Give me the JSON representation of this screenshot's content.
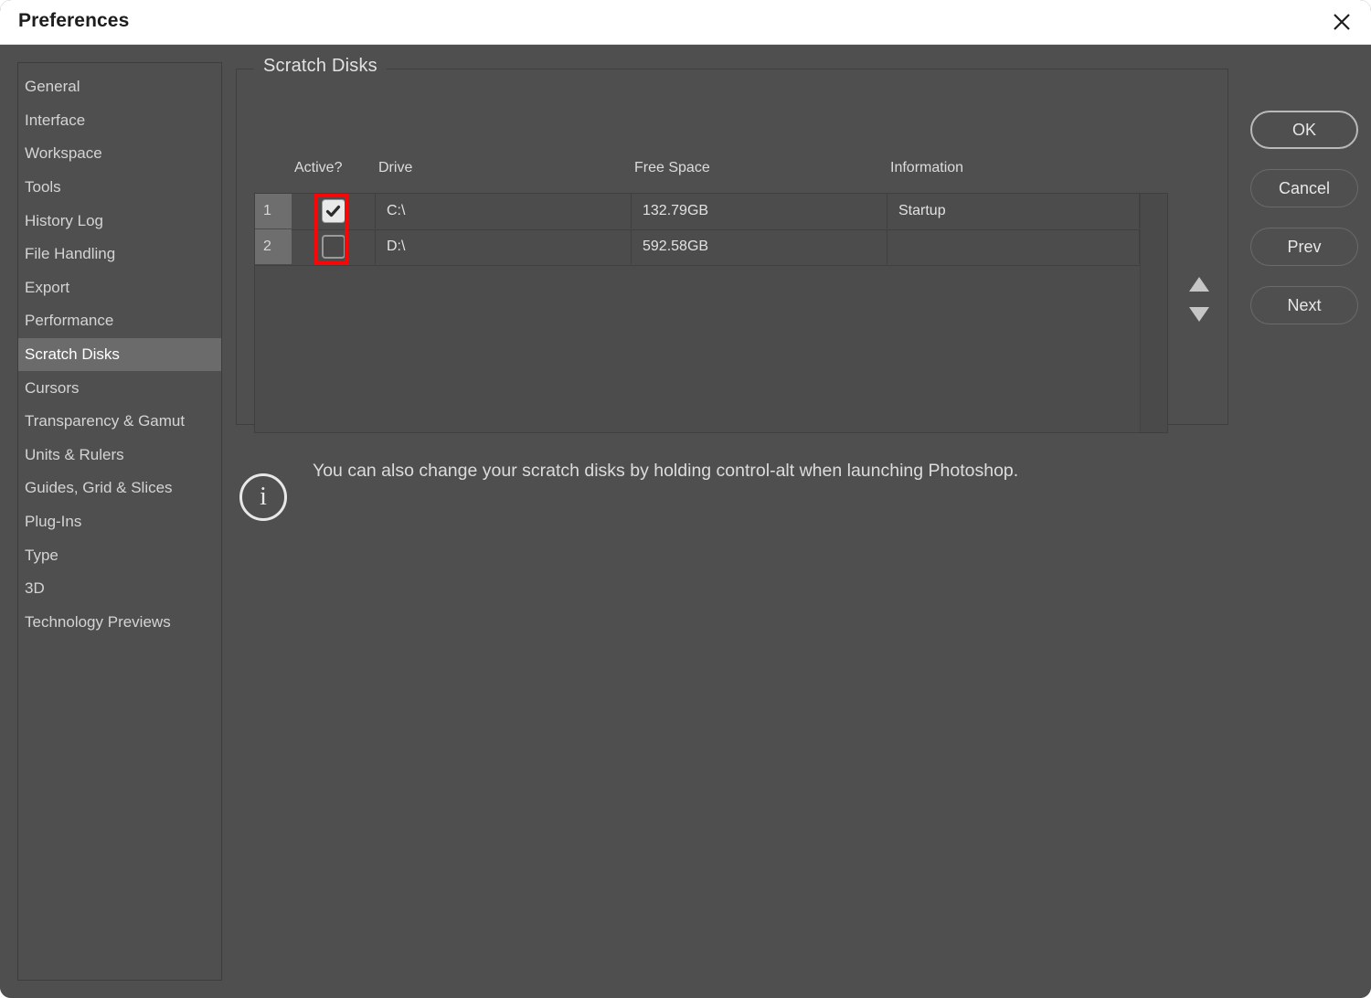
{
  "window": {
    "title": "Preferences",
    "close_icon": "close-icon"
  },
  "sidebar": {
    "items": [
      {
        "label": "General",
        "selected": false
      },
      {
        "label": "Interface",
        "selected": false
      },
      {
        "label": "Workspace",
        "selected": false
      },
      {
        "label": "Tools",
        "selected": false
      },
      {
        "label": "History Log",
        "selected": false
      },
      {
        "label": "File Handling",
        "selected": false
      },
      {
        "label": "Export",
        "selected": false
      },
      {
        "label": "Performance",
        "selected": false
      },
      {
        "label": "Scratch Disks",
        "selected": true
      },
      {
        "label": "Cursors",
        "selected": false
      },
      {
        "label": "Transparency & Gamut",
        "selected": false
      },
      {
        "label": "Units & Rulers",
        "selected": false
      },
      {
        "label": "Guides, Grid & Slices",
        "selected": false
      },
      {
        "label": "Plug-Ins",
        "selected": false
      },
      {
        "label": "Type",
        "selected": false
      },
      {
        "label": "3D",
        "selected": false
      },
      {
        "label": "Technology Previews",
        "selected": false
      }
    ]
  },
  "main": {
    "group_title": "Scratch Disks",
    "columns": {
      "active": "Active?",
      "drive": "Drive",
      "free_space": "Free Space",
      "information": "Information"
    },
    "rows": [
      {
        "num": "1",
        "active": true,
        "drive": "C:\\",
        "free_space": "132.79GB",
        "information": "Startup"
      },
      {
        "num": "2",
        "active": false,
        "drive": "D:\\",
        "free_space": "592.58GB",
        "information": ""
      }
    ],
    "sort_up_icon": "triangle-up-icon",
    "sort_down_icon": "triangle-down-icon",
    "note": {
      "icon": "info-circle-icon",
      "glyph": "i",
      "text": "You can also change your scratch disks by holding control-alt when launching Photoshop."
    }
  },
  "buttons": {
    "ok": "OK",
    "cancel": "Cancel",
    "prev": "Prev",
    "next": "Next"
  },
  "annotation": {
    "color": "#fb0606",
    "target": "active-checkbox-column"
  }
}
